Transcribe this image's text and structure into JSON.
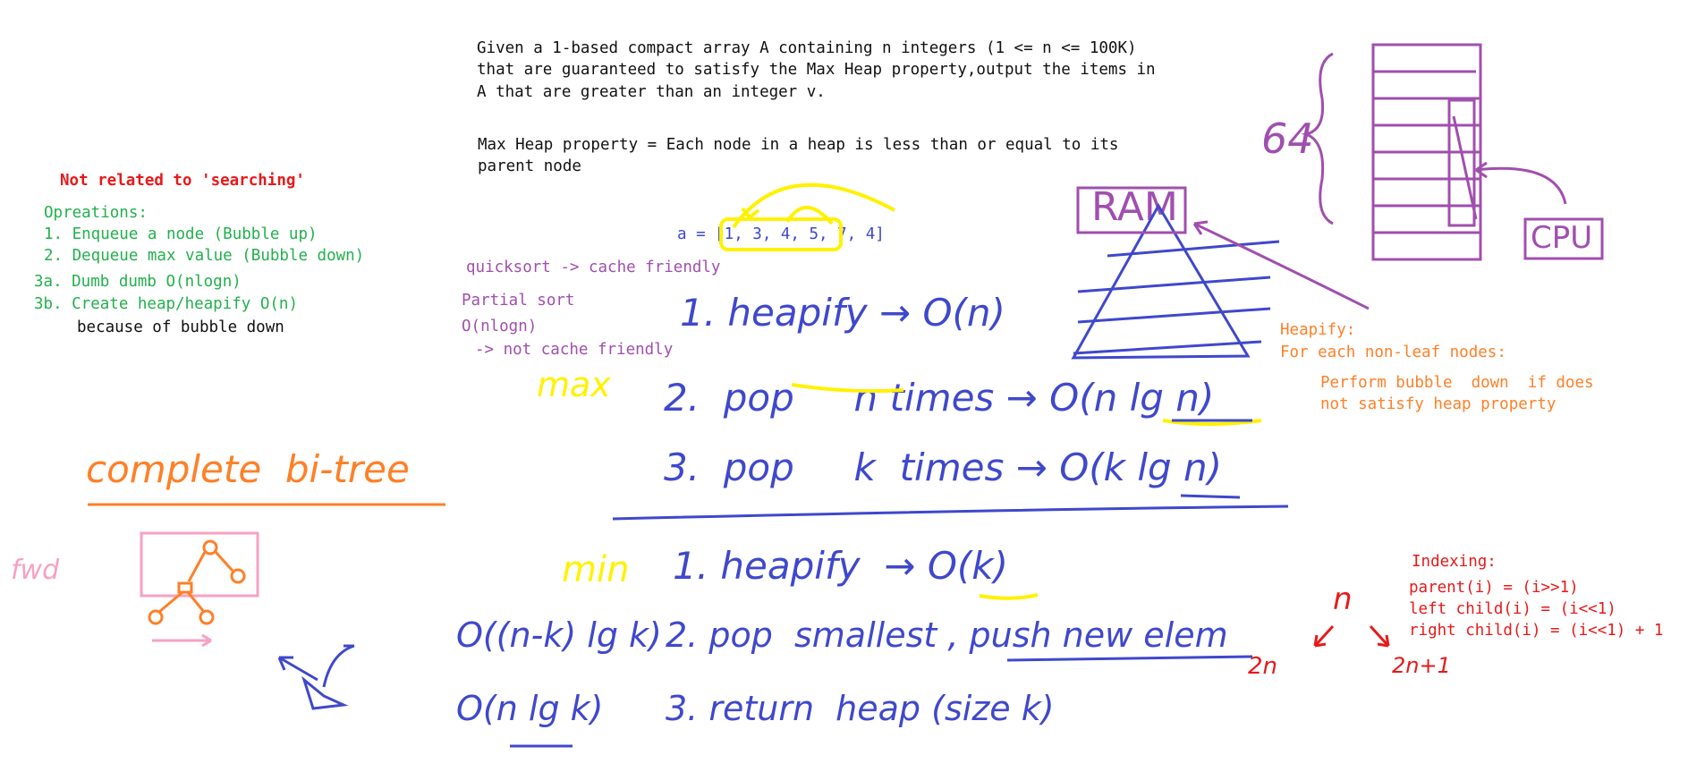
{
  "problem": {
    "lines": [
      "Given a 1-based compact array A containing n integers (1 <= n <= 100K)",
      "that are guaranteed to satisfy the Max Heap property,output the items in",
      "A that are greater than an integer v."
    ],
    "property_lines": [
      "Max Heap property = Each node in a heap is less than or equal to its",
      "parent node"
    ]
  },
  "left_notes": {
    "heading": "Not related to 'searching'",
    "operations_title": "Opreations:",
    "operations": [
      "1. Enqueue a node (Bubble up)",
      "2. Dequeue max value (Bubble down)",
      "3a. Dumb dumb O(nlogn)",
      "3b. Create heap/heapify O(n)"
    ],
    "because": "because of bubble down"
  },
  "array_line": "a = [1, 3, 4, 5, 7, 4]",
  "sort_notes": {
    "quicksort": "quicksort -> cache friendly",
    "partial": "Partial sort",
    "complexity": "O(nlogn)",
    "not_cache": "-> not cache friendly"
  },
  "heapify_note": {
    "title": "Heapify:",
    "line1": "For each non-leaf nodes:",
    "line2": "Perform bubble  down  if does",
    "line3": "not satisfy heap property"
  },
  "indexing": {
    "title": "Indexing:",
    "parent": "parent(i) = (i>>1)",
    "left": "left child(i) = (i<<1)",
    "right": "right child(i) = (i<<1) + 1"
  },
  "handwriting": {
    "max_label": "max",
    "max_step1": "1. heapify → O(n)",
    "max_step2": "2.  pop     n times → O(n lg n)",
    "max_step3": "3.  pop     k  times → O(k lg n)",
    "min_label": "min",
    "min_step1": "1. heapify  → O(k)",
    "min_cost2": "O((n-k) lg k)",
    "min_step2": "2. pop  smallest , push new elem",
    "min_cost3": "O(n lg k)",
    "min_step3": "3. return  heap (size k)",
    "complete": "complete  bi-tree",
    "fwd": "fwd",
    "n_label": "n",
    "two_n": "2n",
    "two_n1": "2n+1",
    "ram": "RAM",
    "cpu": "CPU",
    "size_64": "64"
  },
  "colors": {
    "blue": "#3f48cc",
    "purple": "#a04fae",
    "orange": "#ff7f27",
    "green": "#22b14c",
    "red": "#e8191a",
    "yellow": "#fff200",
    "pink": "#f7a1c4"
  }
}
